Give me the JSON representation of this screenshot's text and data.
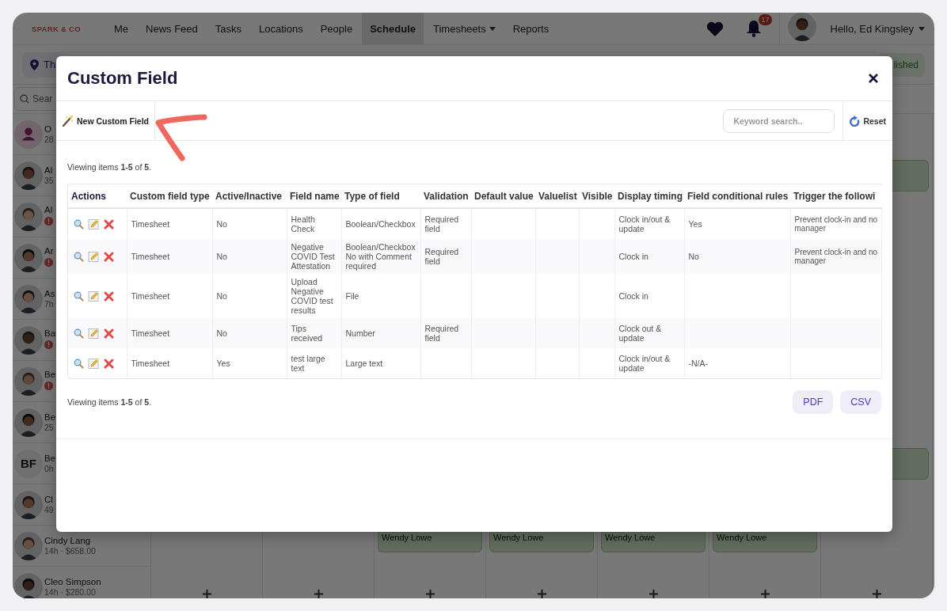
{
  "nav": {
    "brand": "SPARK & CO",
    "items": [
      {
        "label": "Me",
        "selected": false,
        "has_menu": false
      },
      {
        "label": "News Feed",
        "selected": false,
        "has_menu": false
      },
      {
        "label": "Tasks",
        "selected": false,
        "has_menu": false
      },
      {
        "label": "Locations",
        "selected": false,
        "has_menu": false
      },
      {
        "label": "People",
        "selected": false,
        "has_menu": false
      },
      {
        "label": "Schedule",
        "selected": true,
        "has_menu": false
      },
      {
        "label": "Timesheets",
        "selected": false,
        "has_menu": true
      },
      {
        "label": "Reports",
        "selected": false,
        "has_menu": false
      }
    ],
    "notifications": "17",
    "user": "Hello, Ed Kingsley"
  },
  "subbar": {
    "location": "Th",
    "status": "lished"
  },
  "sidebar": {
    "search_placeholder": "Sear",
    "people": [
      {
        "kind": "icon",
        "name": "O",
        "detail": "28",
        "alert": false
      },
      {
        "kind": "photo",
        "name": "Al",
        "detail": "35",
        "alert": false
      },
      {
        "kind": "photo",
        "name": "Al",
        "alert": true
      },
      {
        "kind": "photo",
        "name": "Ar",
        "alert": true
      },
      {
        "kind": "photo",
        "name": "As",
        "detail": "7h",
        "alert": false
      },
      {
        "kind": "photo",
        "name": "Ba",
        "alert": true
      },
      {
        "kind": "photo",
        "name": "Be",
        "alert": true
      },
      {
        "kind": "photo",
        "name": "Be",
        "detail": "25",
        "alert": false
      },
      {
        "kind": "initials",
        "initials": "BF",
        "name": "Be",
        "detail": "0h",
        "alert": false
      },
      {
        "kind": "photo",
        "name": "Cl",
        "detail": "49",
        "alert": false
      },
      {
        "kind": "photo",
        "name": "Cindy Lang",
        "detail": "14h · $658.00",
        "alert": false
      },
      {
        "kind": "photo",
        "name": "Cleo Simpson",
        "detail": "14h · $280.00",
        "alert": false
      }
    ]
  },
  "schedule": {
    "rows": [
      {
        "cells": [
          null,
          null,
          null,
          null,
          null,
          null,
          null
        ],
        "add": false
      },
      {
        "cells": [
          null,
          null,
          null,
          null,
          null,
          null,
          {
            "kind": "shift"
          }
        ],
        "add": false
      },
      {
        "cells": [
          null,
          null,
          null,
          null,
          null,
          null,
          null
        ],
        "add": false
      },
      {
        "cells": [
          null,
          null,
          null,
          null,
          null,
          null,
          null
        ],
        "add": false
      },
      {
        "cells": [
          null,
          null,
          null,
          null,
          null,
          null,
          null
        ],
        "add": false
      },
      {
        "cells": [
          null,
          null,
          null,
          null,
          null,
          null,
          null
        ],
        "add": false
      },
      {
        "cells": [
          null,
          null,
          null,
          null,
          null,
          null,
          null
        ],
        "add": false
      },
      {
        "cells": [
          null,
          null,
          null,
          null,
          null,
          null,
          null
        ],
        "add": false
      },
      {
        "cells": [
          null,
          null,
          null,
          null,
          null,
          null,
          {
            "kind": "shift"
          }
        ],
        "add": false
      },
      {
        "cells": [
          null,
          null,
          null,
          null,
          null,
          null,
          null
        ],
        "add": false
      },
      {
        "cells": [
          null,
          null,
          {
            "kind": "shift",
            "name": "Wendy Lowe"
          },
          {
            "kind": "shift",
            "name": "Wendy Lowe"
          },
          {
            "kind": "shift",
            "name": "Wendy Lowe"
          },
          {
            "kind": "shift",
            "name": "Wendy Lowe"
          },
          null
        ],
        "add": false
      },
      {
        "cells": [
          null,
          null,
          null,
          null,
          null,
          null,
          null
        ],
        "add": true
      }
    ]
  },
  "modal": {
    "title": "Custom Field",
    "new_button": "New Custom Field",
    "search_placeholder": "Keyword search..",
    "reset": "Reset",
    "summary_top": "Viewing items **1-5** of **5**.",
    "actions_header": "Actions",
    "columns": [
      "Custom field type",
      "Active/Inactive",
      "Field name",
      "Type of field",
      "Validation",
      "Default value",
      "Valuelist",
      "Visible",
      "Display timing",
      "Field conditional rules",
      "Trigger the followi"
    ],
    "rows": [
      {
        "cells": [
          "Timesheet",
          "No",
          "Health Check",
          "Boolean/Checkbox",
          "Required field",
          null,
          null,
          null,
          "Clock in/out & update",
          "Yes",
          "Prevent clock-in and no\nmanager"
        ]
      },
      {
        "cells": [
          "Timesheet",
          "No",
          "Negative COVID Test Attestation",
          "Boolean/Checkbox No with Comment required",
          "Required field",
          null,
          null,
          null,
          "Clock in",
          "No",
          "Prevent clock-in and no\nmanager"
        ]
      },
      {
        "cells": [
          "Timesheet",
          "No",
          "Upload Negative COVID test results",
          "File",
          null,
          null,
          null,
          null,
          "Clock in",
          null,
          null
        ]
      },
      {
        "cells": [
          "Timesheet",
          "No",
          "Tips received",
          "Number",
          "Required field",
          null,
          null,
          null,
          "Clock out & update",
          null,
          null
        ]
      },
      {
        "cells": [
          "Timesheet",
          "Yes",
          "test large text",
          "Large text",
          null,
          null,
          null,
          null,
          "Clock in/out & update",
          "-N/A-",
          null
        ]
      }
    ],
    "summary_bottom": "Viewing items **1-5** of **5**.",
    "exports": [
      "PDF",
      "CSV"
    ]
  }
}
